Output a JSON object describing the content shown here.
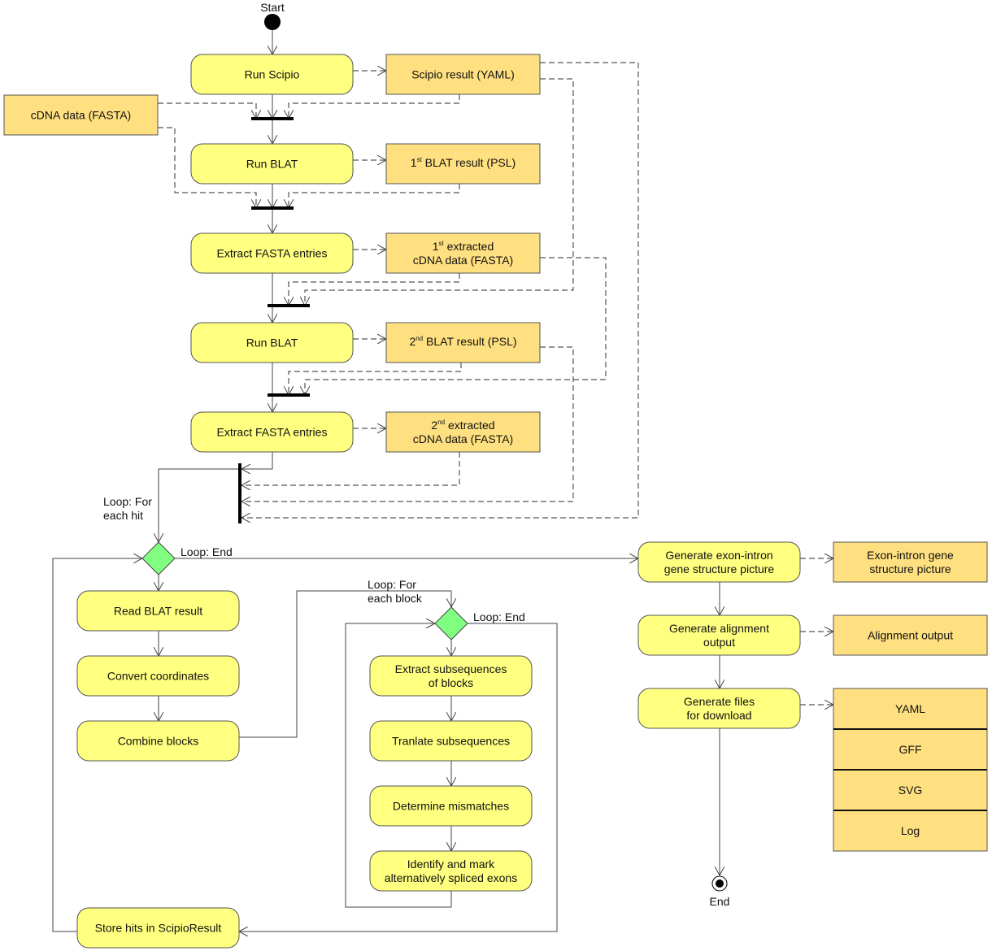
{
  "start_label": "Start",
  "end_label": "End",
  "actions": {
    "run_scipio": [
      "Run Scipio"
    ],
    "run_blat_1": [
      "Run BLAT"
    ],
    "extract_1": [
      "Extract FASTA entries"
    ],
    "run_blat_2": [
      "Run BLAT"
    ],
    "extract_2": [
      "Extract FASTA entries"
    ],
    "read_blat": [
      "Read BLAT result"
    ],
    "convert": [
      "Convert coordinates"
    ],
    "combine": [
      "Combine blocks"
    ],
    "store": [
      "Store hits in ScipioResult"
    ],
    "extract_sub": [
      "Extract subsequences",
      "of blocks"
    ],
    "translate": [
      "Tranlate subsequences"
    ],
    "mismatches": [
      "Determine mismatches"
    ],
    "identify": [
      "Identify and mark",
      "alternatively spliced exons"
    ],
    "gen_picture": [
      "Generate exon-intron",
      "gene structure picture"
    ],
    "gen_alignment": [
      "Generate alignment",
      "output"
    ],
    "gen_files": [
      "Generate files",
      "for download"
    ]
  },
  "objects": {
    "scipio_result": [
      "Scipio result (YAML)"
    ],
    "cdna": [
      "cDNA data (FASTA)"
    ],
    "blat_result_1": {
      "num": "1",
      "sup": "st",
      "rest": " BLAT result (PSL)"
    },
    "extracted_1": {
      "num": "1",
      "sup": "st",
      "rest": " extracted",
      "line2": "cDNA data (FASTA)"
    },
    "blat_result_2": {
      "num": "2",
      "sup": "nd",
      "rest": " BLAT result (PSL)"
    },
    "extracted_2": {
      "num": "2",
      "sup": "nd",
      "rest": " extracted",
      "line2": "cDNA data (FASTA)"
    },
    "picture": [
      "Exon-intron gene",
      "structure picture"
    ],
    "alignment": [
      "Alignment output"
    ],
    "files": [
      "YAML",
      "GFF",
      "SVG",
      "Log"
    ]
  },
  "guards": {
    "loop_hit": [
      "Loop: For",
      "each hit"
    ],
    "loop_hit_end": "Loop: End",
    "loop_block": [
      "Loop: For",
      "each block"
    ],
    "loop_block_end": "Loop: End"
  },
  "colors": {
    "action": "#ffff80",
    "object": "#ffe080",
    "decision": "#80ff80"
  }
}
